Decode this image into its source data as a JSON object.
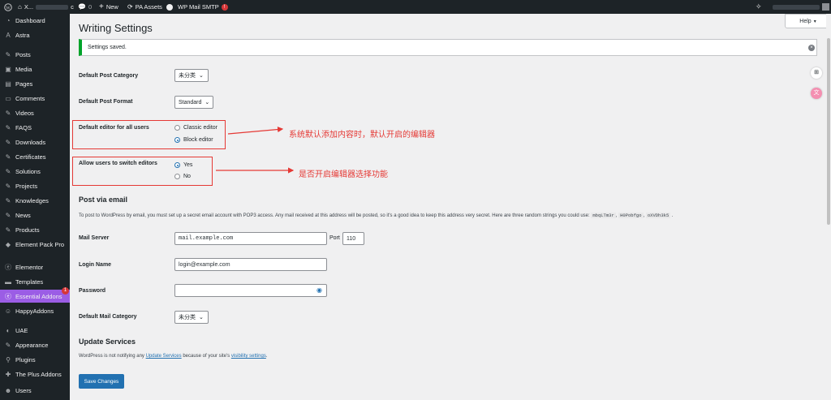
{
  "adminbar": {
    "site_name": "X...",
    "site_suffix": "c",
    "comments_count": "0",
    "new_label": "New",
    "pa_assets_label": "PA Assets",
    "wp_mail_label": "WP Mail SMTP",
    "wp_mail_badge": "!"
  },
  "sidebar": {
    "items": [
      {
        "label": "Dashboard",
        "icon": "dashboard-icon"
      },
      {
        "label": "Astra",
        "icon": "astra-icon"
      },
      {
        "label": "Posts",
        "icon": "pin-icon"
      },
      {
        "label": "Media",
        "icon": "media-icon"
      },
      {
        "label": "Pages",
        "icon": "page-icon"
      },
      {
        "label": "Comments",
        "icon": "comment-icon"
      },
      {
        "label": "Videos",
        "icon": "pin-icon"
      },
      {
        "label": "FAQS",
        "icon": "pin-icon"
      },
      {
        "label": "Downloads",
        "icon": "pin-icon"
      },
      {
        "label": "Certificates",
        "icon": "pin-icon"
      },
      {
        "label": "Solutions",
        "icon": "pin-icon"
      },
      {
        "label": "Projects",
        "icon": "pin-icon"
      },
      {
        "label": "Knowledges",
        "icon": "pin-icon"
      },
      {
        "label": "News",
        "icon": "pin-icon"
      },
      {
        "label": "Products",
        "icon": "pin-icon"
      },
      {
        "label": "Element Pack Pro",
        "icon": "element-pack-icon"
      },
      {
        "label": "Elementor",
        "icon": "elementor-icon"
      },
      {
        "label": "Templates",
        "icon": "templates-icon"
      },
      {
        "label": "Essential Addons",
        "icon": "ea-icon",
        "badge": "1"
      },
      {
        "label": "HappyAddons",
        "icon": "happy-icon"
      },
      {
        "label": "UAE",
        "icon": "uae-icon"
      },
      {
        "label": "Appearance",
        "icon": "brush-icon"
      },
      {
        "label": "Plugins",
        "icon": "plugin-icon"
      },
      {
        "label": "The Plus Addons",
        "icon": "plus-icon"
      },
      {
        "label": "Users",
        "icon": "users-icon"
      }
    ]
  },
  "page": {
    "title": "Writing Settings",
    "help_label": "Help",
    "notice": "Settings saved."
  },
  "form": {
    "default_category_label": "Default Post Category",
    "default_category_value": "未分类",
    "default_format_label": "Default Post Format",
    "default_format_value": "Standard",
    "editor_label": "Default editor for all users",
    "editor_options": [
      "Classic editor",
      "Block editor"
    ],
    "editor_selected": 1,
    "switch_label": "Allow users to switch editors",
    "switch_options": [
      "Yes",
      "No"
    ],
    "switch_selected": 0
  },
  "annotations": {
    "editor_note": "系统默认添加内容时，默认开启的编辑器",
    "switch_note": "是否开启编辑器选择功能"
  },
  "email": {
    "heading": "Post via email",
    "description": "To post to WordPress by email, you must set up a secret email account with POP3 access. Any mail received at this address will be posted, so it's a good idea to keep this address very secret. Here are three random strings you could use:",
    "codes": [
      "mbqLTm3r",
      "H0Pobfgo",
      "oXVDh3k5"
    ],
    "mail_server_label": "Mail Server",
    "mail_server_value": "mail.example.com",
    "port_label": "Port",
    "port_value": "110",
    "login_label": "Login Name",
    "login_value": "login@example.com",
    "password_label": "Password",
    "mail_category_label": "Default Mail Category",
    "mail_category_value": "未分类"
  },
  "update": {
    "heading": "Update Services",
    "text_before": "WordPress is not notifying any",
    "link1": "Update Services",
    "text_middle": "because of your site's",
    "link2": "visibility settings",
    "text_after": ".",
    "save_label": "Save Changes"
  },
  "colors": {
    "accent": "#2271b1",
    "annotation": "#e53935",
    "success": "#00a32a",
    "active_menu": "#9b5de5"
  }
}
